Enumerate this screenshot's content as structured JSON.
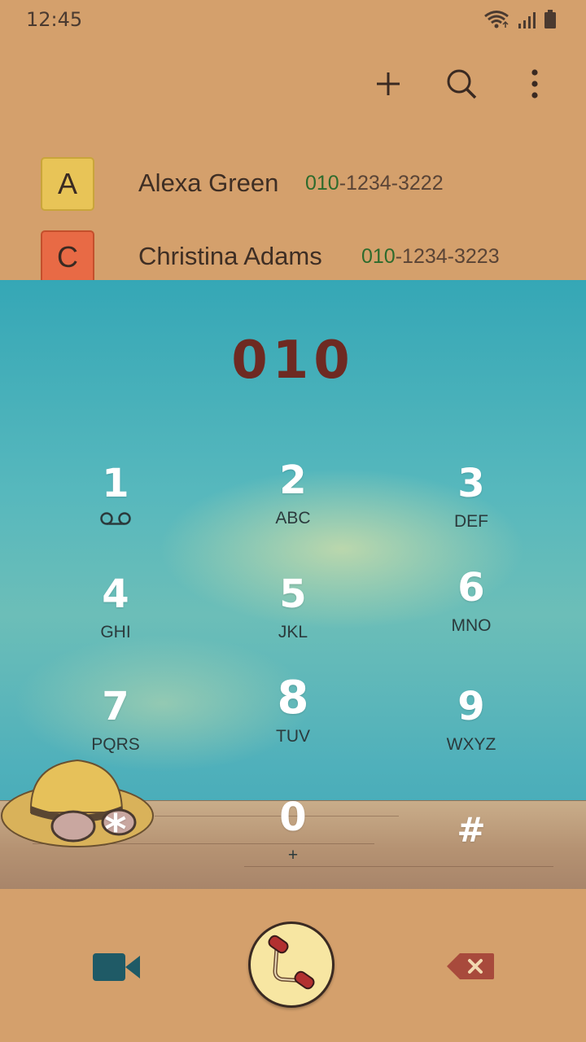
{
  "status_bar": {
    "time": "12:45"
  },
  "toolbar": {
    "add_icon": "plus-icon",
    "search_icon": "search-icon",
    "more_icon": "more-vert-icon"
  },
  "contacts": [
    {
      "initial": "A",
      "name": "Alexa Green",
      "number_match": "010",
      "number_rest": "-1234-3222",
      "avatar_color": "#E8C457",
      "avatar_border": "#c9a53a"
    },
    {
      "initial": "C",
      "name": "Christina Adams",
      "number_match": "010",
      "number_rest": "-1234-3223",
      "avatar_color": "#E86A45",
      "avatar_border": "#c44f2c"
    }
  ],
  "dialer": {
    "entered_number": "010",
    "keys": [
      {
        "digit": "1",
        "letters": "",
        "sub_icon": "voicemail-icon"
      },
      {
        "digit": "2",
        "letters": "ABC"
      },
      {
        "digit": "3",
        "letters": "DEF"
      },
      {
        "digit": "4",
        "letters": "GHI"
      },
      {
        "digit": "5",
        "letters": "JKL"
      },
      {
        "digit": "6",
        "letters": "MNO"
      },
      {
        "digit": "7",
        "letters": "PQRS"
      },
      {
        "digit": "8",
        "letters": "TUV"
      },
      {
        "digit": "9",
        "letters": "WXYZ"
      },
      {
        "digit": "*",
        "letters": ""
      },
      {
        "digit": "0",
        "letters": "+"
      },
      {
        "digit": "#",
        "letters": ""
      }
    ]
  },
  "bottom_bar": {
    "video_call_icon": "video-camera-icon",
    "call_icon": "phone-handset-icon",
    "backspace_icon": "backspace-icon"
  },
  "colors": {
    "background": "#D4A06C",
    "number_display": "#6E2A22",
    "match_highlight": "#2D6B2D",
    "video_icon": "#1F5A66",
    "backspace_icon": "#A84A3C"
  }
}
